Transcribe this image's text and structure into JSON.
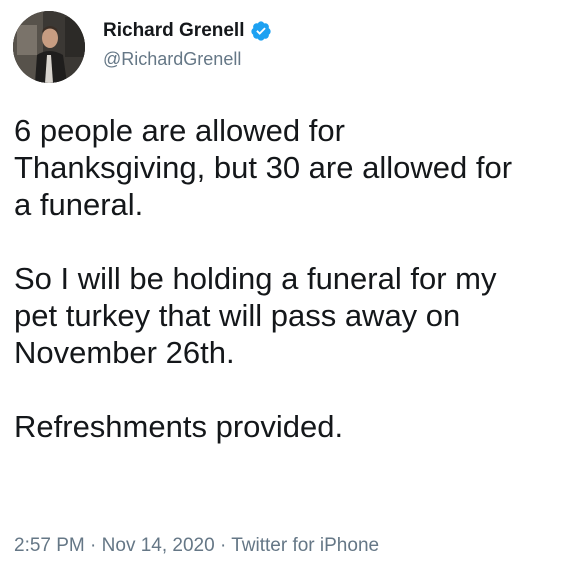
{
  "author": {
    "display_name": "Richard Grenell",
    "handle": "@RichardGrenell",
    "verified_icon": "verified-badge-icon",
    "badge_color": "#1da1f2"
  },
  "tweet": {
    "paragraphs": [
      "6 people are allowed for\nThanksgiving, but 30 are allowed for\na funeral.",
      "So I will be holding a funeral for my\npet turkey that will pass away on\nNovember 26th.",
      "Refreshments provided."
    ]
  },
  "meta": {
    "time": "2:57 PM",
    "separator": "·",
    "date": "Nov 14, 2020",
    "source": "Twitter for iPhone"
  }
}
